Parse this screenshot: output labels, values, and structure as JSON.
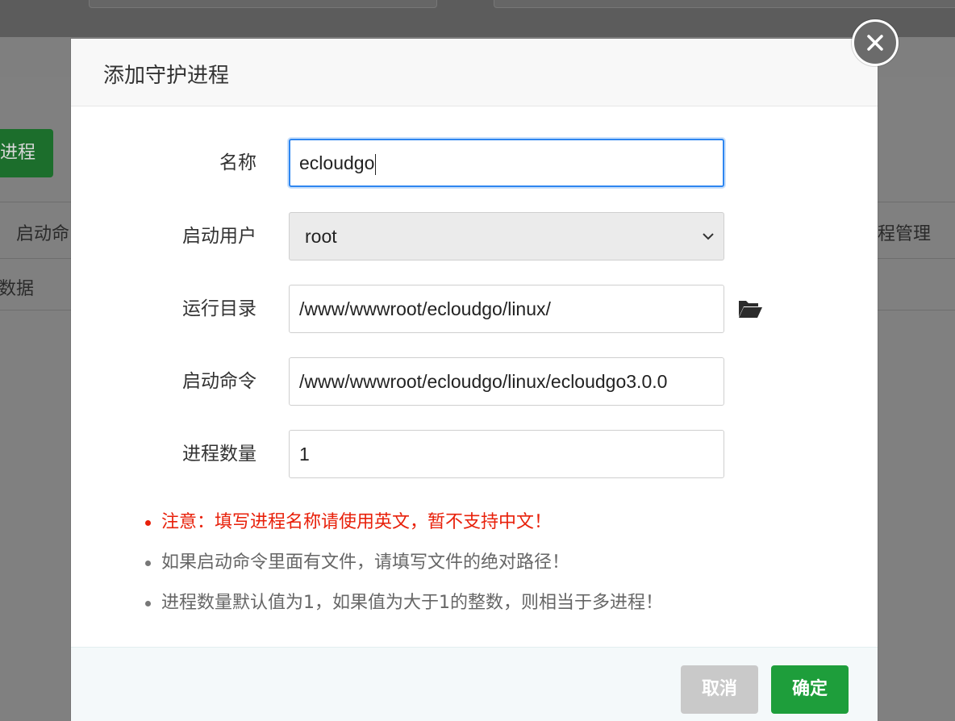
{
  "background": {
    "add_button_label": "进程",
    "table_header_left": "启动命",
    "table_header_right": "程管理",
    "table_empty_text": "数据"
  },
  "modal": {
    "title": "添加守护进程",
    "fields": {
      "name": {
        "label": "名称",
        "value": "ecloudgo"
      },
      "user": {
        "label": "启动用户",
        "selected": "root"
      },
      "run_dir": {
        "label": "运行目录",
        "value": "/www/wwwroot/ecloudgo/linux/"
      },
      "start_cmd": {
        "label": "启动命令",
        "value": "/www/wwwroot/ecloudgo/linux/ecloudgo3.0.0"
      },
      "process_count": {
        "label": "进程数量",
        "value": "1"
      }
    },
    "notes": [
      "注意：填写进程名称请使用英文，暂不支持中文！",
      "如果启动命令里面有文件，请填写文件的绝对路径！",
      "进程数量默认值为1，如果值为大于1的整数，则相当于多进程！"
    ],
    "buttons": {
      "cancel": "取消",
      "ok": "确定"
    }
  },
  "colors": {
    "accent_blue": "#2e86f0",
    "ok_green": "#1e9e3b",
    "warning_red": "#e8200a",
    "cancel_gray": "#c9c9c9"
  },
  "icons": {
    "close": "close-icon",
    "folder": "folder-open-icon",
    "select": "chevron-down-icon"
  }
}
